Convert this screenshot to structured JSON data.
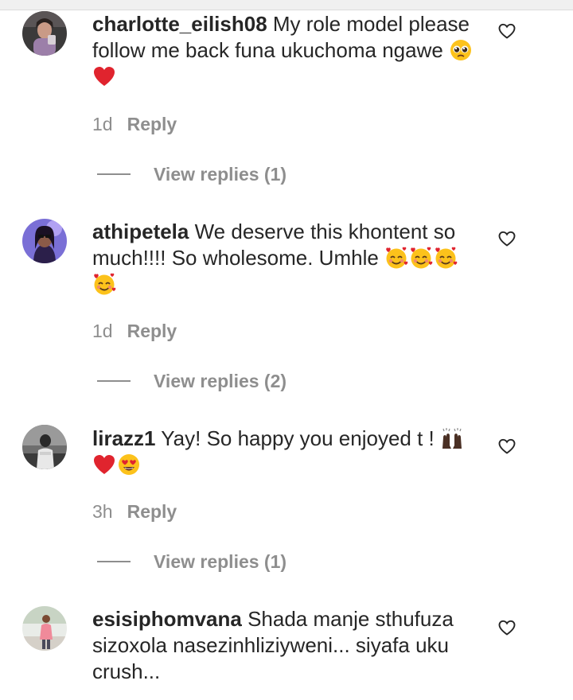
{
  "comments": [
    {
      "username": "charlotte_eilish08",
      "text": " My role model please follow me back funa ukuchoma ngawe ",
      "emojis": [
        "pleading-face",
        "red-heart"
      ],
      "time": "1d",
      "reply": "Reply",
      "view_replies": "View replies (1)"
    },
    {
      "username": "athipetela",
      "text": " We deserve this khontent so much!!!! So wholesome. Umhle ",
      "emojis": [
        "smiling-face-with-hearts",
        "smiling-face-with-hearts",
        "smiling-face-with-hearts",
        "smiling-face-with-hearts"
      ],
      "time": "1d",
      "reply": "Reply",
      "view_replies": "View replies (2)"
    },
    {
      "username": "lirazz1",
      "text": " Yay! So happy you enjoyed t ! ",
      "emojis": [
        "raising-hands",
        "red-heart",
        "heart-eyes"
      ],
      "time": "3h",
      "reply": "Reply",
      "view_replies": "View replies (1)"
    },
    {
      "username": "esisiphomvana",
      "text": " Shada manje sthufuza sizoxola nasezinhliziyweni... siyafa uku crush...",
      "emojis": [],
      "time": "",
      "reply": "",
      "view_replies": ""
    }
  ],
  "icons": {
    "like": "heart-outline-icon"
  },
  "colors": {
    "text": "#262626",
    "secondary": "#8e8e8e",
    "background": "#ffffff"
  }
}
